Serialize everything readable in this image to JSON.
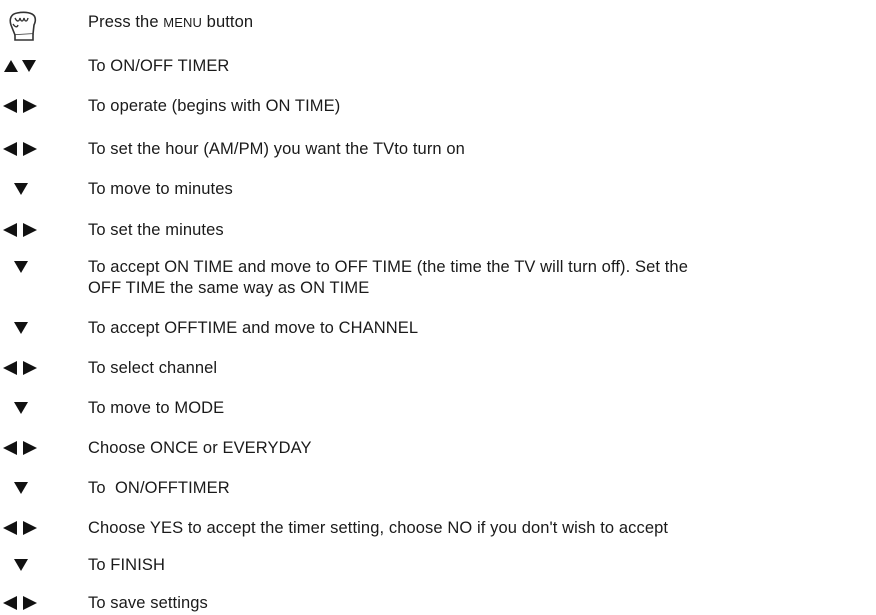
{
  "steps": [
    {
      "icon": "hand-press-icon",
      "text_pre": "Press the ",
      "text_caps": "Menu",
      "text_post": " button"
    },
    {
      "icon": "up-down-arrows-icon",
      "text": "To ON/OFF TIMER"
    },
    {
      "icon": "left-right-arrows-icon",
      "text": "To operate (begins with ON TIME)"
    },
    {
      "icon": "left-right-arrows-icon",
      "text": "To set the hour (AM/PM) you want the TVto turn on"
    },
    {
      "icon": "down-arrow-icon",
      "text": "To move to minutes"
    },
    {
      "icon": "left-right-arrows-icon",
      "text": "To set the minutes"
    },
    {
      "icon": "down-arrow-icon",
      "text_line1": "To accept ON TIME and move to OFF TIME (the time the TV will turn off). Set the",
      "text_line2": "OFF TIME the same way as ON TIME"
    },
    {
      "icon": "down-arrow-icon",
      "text": "To accept OFFTIME and move to CHANNEL"
    },
    {
      "icon": "left-right-arrows-icon",
      "text": "To select channel"
    },
    {
      "icon": "down-arrow-icon",
      "text": "To move to MODE"
    },
    {
      "icon": "left-right-arrows-icon",
      "text": "Choose ONCE or EVERYDAY"
    },
    {
      "icon": "down-arrow-icon",
      "text": "To  ON/OFFTIMER"
    },
    {
      "icon": "left-right-arrows-icon",
      "text": "Choose YES to accept the timer setting, choose NO if you don't wish to accept"
    },
    {
      "icon": "down-arrow-icon",
      "text": "To FINISH"
    },
    {
      "icon": "left-right-arrows-icon",
      "text": "To save settings"
    }
  ],
  "colors": {
    "text": "#1a1a1a",
    "icon": "#111111"
  }
}
